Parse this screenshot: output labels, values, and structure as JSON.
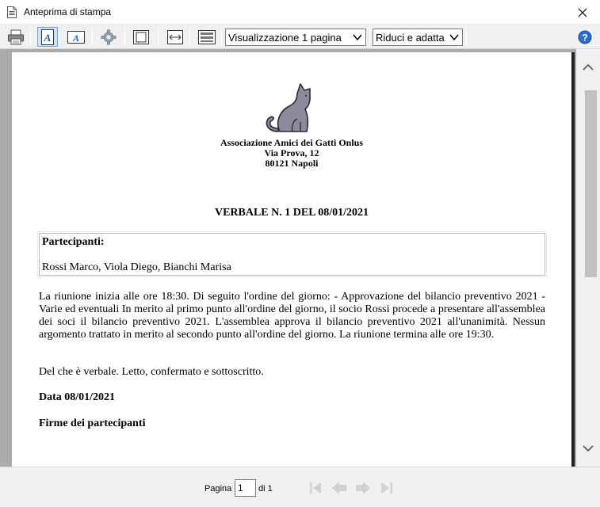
{
  "window": {
    "title": "Anteprima di stampa"
  },
  "toolbar": {
    "view_mode": "Visualizzazione 1 pagina",
    "zoom_mode": "Riduci e adatta"
  },
  "document": {
    "organization": {
      "name": "Associazione Amici dei Gatti Onlus",
      "address": "Via Prova, 12",
      "city": "80121 Napoli"
    },
    "title": "VERBALE N. 1 DEL 08/01/2021",
    "participants_label": "Partecipanti:",
    "participants": "Rossi Marco, Viola Diego, Bianchi Marisa",
    "body": "La riunione inizia alle ore 18:30. Di seguito l'ordine del giorno: - Approvazione del bilancio preventivo 2021 - Varie ed eventuali In merito al primo punto all'ordine del giorno, il socio Rossi procede a presentare all'assemblea dei soci il bilancio preventivo 2021. L'assemblea approva il bilancio preventivo 2021 all'unanimità. Nessun argomento trattato in merito al secondo punto all'ordine del giorno. La riunione termina alle ore 19:30.",
    "closing": "Del che è verbale. Letto, confermato e sottoscritto.",
    "date_line": "Data 08/01/2021",
    "signatures": "Firme dei partecipanti"
  },
  "footer": {
    "page_label": "Pagina",
    "page_value": "1",
    "page_of": "di 1"
  },
  "colors": {
    "accent": "#1f5fb5",
    "cat": "#8e8a9e",
    "preview_bg": "#ababab"
  }
}
